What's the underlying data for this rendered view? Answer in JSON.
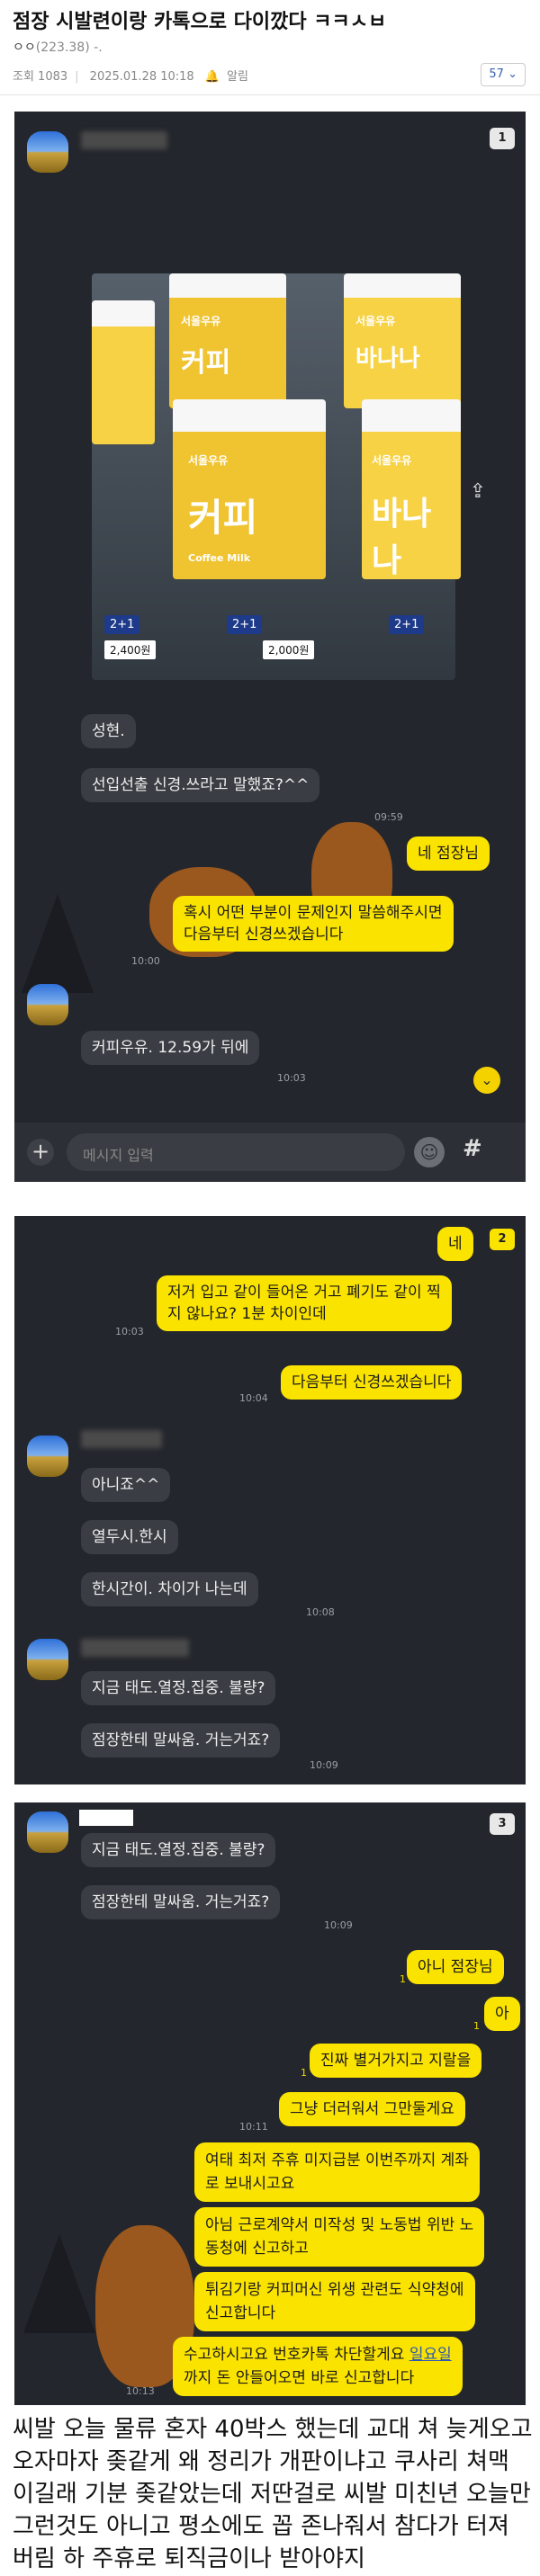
{
  "post": {
    "title": "점장 시발련이랑 카톡으로 다이깠다 ㅋㅋㅅㅂ",
    "author": "ㅇㅇ",
    "author_ip": "(223.38)",
    "author_sep": "-.",
    "views_label": "조회 1083",
    "date": "2025.01.28 10:18",
    "alarm": "알림",
    "comments": "57",
    "comment_chevron": "⌄"
  },
  "shot1": {
    "badge": "1",
    "milk_label": "서울우유",
    "coffee_text": "커피",
    "banana_text": "바나나",
    "coffee_sub": "Coffee Milk",
    "price_a": "2+1",
    "price_b": "2,400원",
    "price_c": "2,000원",
    "msgs": [
      {
        "text": "성현.",
        "time": ""
      },
      {
        "text": "선입선출 신경.쓰라고 말했죠?^^",
        "time": "09:59"
      },
      {
        "text": "네 점장님",
        "time": ""
      },
      {
        "text": "혹시 어떤 부분이 문제인지 말씀해주시면\n다음부터 신경쓰겠습니다",
        "time": "10:00"
      },
      {
        "text": "커피우유. 12.59가 뒤에",
        "time": "10:03"
      }
    ],
    "input_placeholder": "메시지 입력",
    "emoji_icon": "☺",
    "hash_icon": "#",
    "plus_icon": "+",
    "share_icon": "⇪"
  },
  "shot2": {
    "badge": "2",
    "msgs": [
      {
        "text": "네",
        "time": ""
      },
      {
        "text": "저거 입고 같이 들어온 거고 폐기도 같이 찍\n지 않나요? 1분 차이인데",
        "time": "10:03"
      },
      {
        "text": "다음부터 신경쓰겠습니다",
        "time": "10:04"
      },
      {
        "text": "아니죠^^",
        "time": ""
      },
      {
        "text": "열두시.한시",
        "time": ""
      },
      {
        "text": "한시간이. 차이가 나는데",
        "time": "10:08"
      },
      {
        "text": "지금 태도.열정.집중. 불량?",
        "time": ""
      },
      {
        "text": "점장한테 말싸움. 거는거죠?",
        "time": "10:09"
      }
    ]
  },
  "shot3": {
    "badge": "3",
    "msgs": [
      {
        "text": "지금 태도.열정.집중. 불량?",
        "time": ""
      },
      {
        "text": "점장한테 말싸움. 거는거죠?",
        "time": "10:09"
      },
      {
        "text": "아니 점장님",
        "time": ""
      },
      {
        "text": "아",
        "time": ""
      },
      {
        "text": "진짜 별거가지고 지랄을",
        "time": ""
      },
      {
        "text": "그냥 더러워서 그만둘게요",
        "time": "10:11"
      },
      {
        "text": "여태 최저 주휴 미지급분 이번주까지 계좌\n로 보내시고요",
        "time": ""
      },
      {
        "text": "아님 근로계약서 미작성 및 노동법 위반 노\n동청에 신고하고",
        "time": ""
      },
      {
        "text": "튀김기랑 커피머신 위생 관련도 식약청에\n신고합니다",
        "time": ""
      },
      {
        "text": "수고하시고요 번호카톡 차단할게요 ",
        "link": "일요일",
        "text2": "\n까지 돈 안들어오면 바로 신고합니다",
        "time": "10:13"
      }
    ],
    "unread": "1"
  },
  "caption": [
    "씨발 오늘 물류 혼자 40박스 했는데 교대 쳐 늦게오고",
    "오자마자 좆같게 왜 정리가 개판이냐고 쿠사리 쳐맥",
    "이길래 기분 좆같았는데 저딴걸로 씨발 미친년 오늘만",
    "그런것도 아니고 평소에도 꼽 존나줘서 참다가 터져",
    "버림 하 주휴로 퇴직금이나 받아야지"
  ],
  "colors": {
    "chat_bg": "#23262c",
    "my_bubble": "#fbe300",
    "other_bubble": "#3a3d43"
  }
}
